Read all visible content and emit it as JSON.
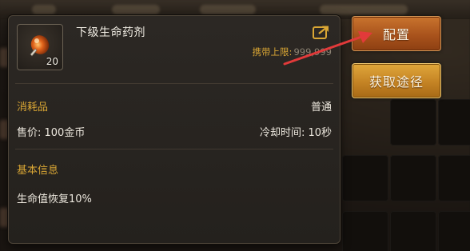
{
  "item": {
    "name": "下级生命药剂",
    "count": "20",
    "icon": "potion-icon",
    "carry_limit_label": "携带上限:",
    "carry_limit_value": "999,999",
    "category": "消耗品",
    "rarity": "普通",
    "price": "售价: 100金币",
    "cooldown": "冷却时间: 10秒",
    "basic_info_title": "基本信息",
    "effect": "生命值恢复10%"
  },
  "actions": {
    "configure_label": "配置",
    "source_label": "获取途径"
  },
  "colors": {
    "gold_label": "#d9a634",
    "config_button": "#a9531c",
    "source_button": "#c48324",
    "annotation_arrow": "#e23a3a"
  }
}
